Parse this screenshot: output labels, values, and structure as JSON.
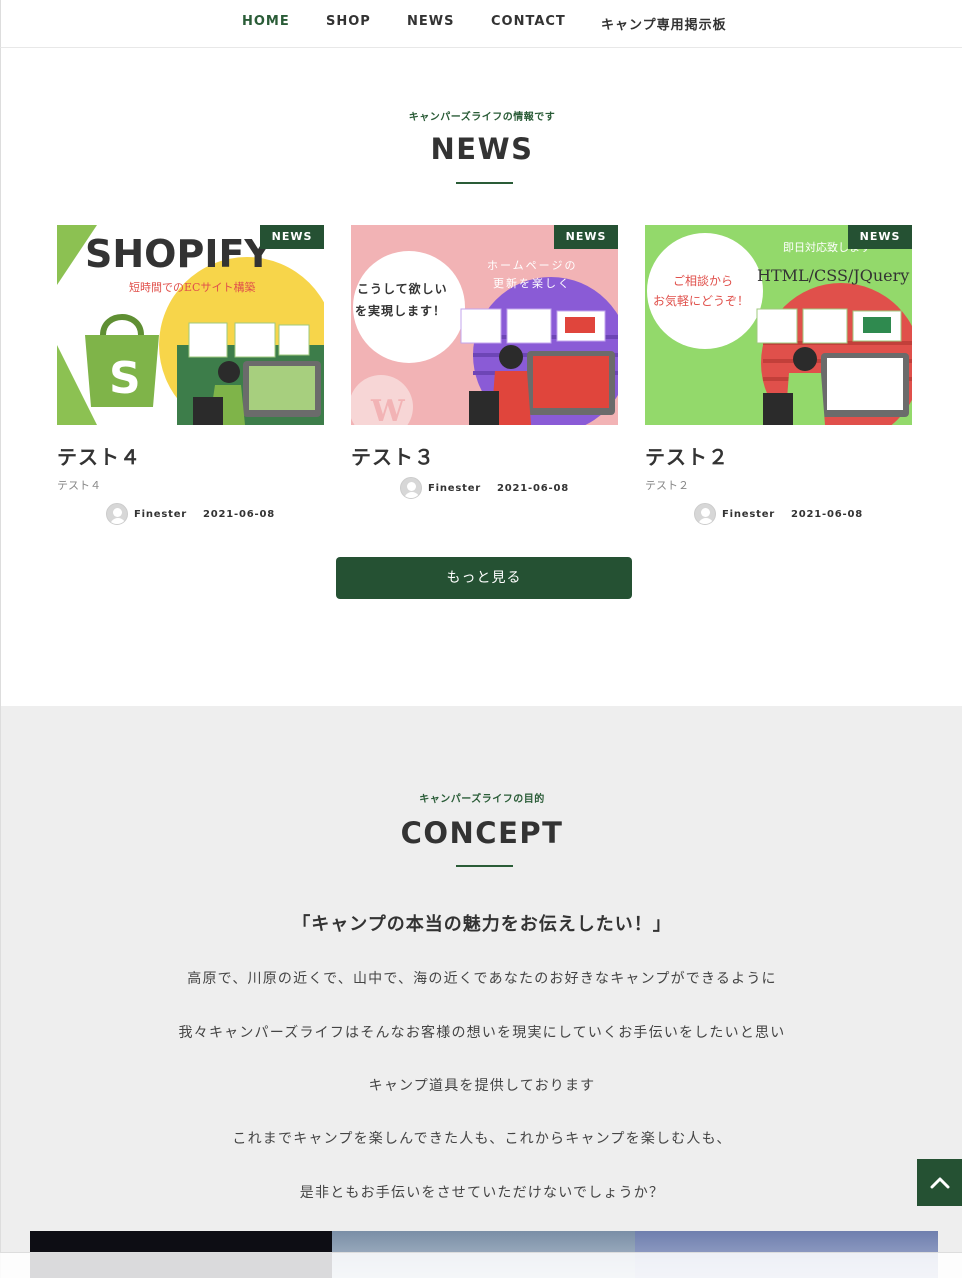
{
  "nav": {
    "items": [
      {
        "label": "HOME",
        "active": true
      },
      {
        "label": "SHOP",
        "active": false
      },
      {
        "label": "NEWS",
        "active": false
      },
      {
        "label": "CONTACT",
        "active": false
      },
      {
        "label": "キャンプ専用掲示板",
        "active": false
      }
    ]
  },
  "news": {
    "subtitle": "キャンパーズライフの情報です",
    "title": "NEWS",
    "cards": [
      {
        "badge": "NEWS",
        "title": "テスト４",
        "excerpt": "テスト４",
        "author": "Finester",
        "date": "2021-06-08",
        "image": {
          "headline": "SHOPIFY",
          "caption": "短時間でのECサイト構築"
        }
      },
      {
        "badge": "NEWS",
        "title": "テスト３",
        "excerpt": "",
        "author": "Finester",
        "date": "2021-06-08",
        "image": {
          "bubble_line1": "こうして欲しい",
          "bubble_line2": "を実現します！",
          "caption_line1": "ホームページの",
          "caption_line2": "更新を楽しく"
        }
      },
      {
        "badge": "NEWS",
        "title": "テスト２",
        "excerpt": "テスト２",
        "author": "Finester",
        "date": "2021-06-08",
        "image": {
          "top_text": "即日対応致します",
          "headline": "HTML/CSS/JQuery",
          "bubble_line1": "ご相談から",
          "bubble_line2": "お気軽にどうぞ！"
        }
      }
    ],
    "more_label": "もっと見る"
  },
  "concept": {
    "subtitle": "キャンパーズライフの目的",
    "title": "CONCEPT",
    "lead": "「キャンプの本当の魅力をお伝えしたい！」",
    "paragraphs": [
      "高原で、川原の近くで、山中で、海の近くであなたのお好きなキャンプができるように",
      "我々キャンパーズライフはそんなお客様の想いを現実にしていくお手伝いをしたいと思い",
      "キャンプ道具を提供しております",
      "これまでキャンプを楽しんできた人も、これからキャンプを楽しむ人も、",
      "是非ともお手伝いをさせていただけないでしょうか？"
    ]
  },
  "colors": {
    "accent": "#255133",
    "accent_text": "#2a5c37",
    "concept_bg": "#eeeeee"
  },
  "icons": {
    "scroll_top": "chevron-up-icon",
    "avatar": "default-avatar-icon"
  }
}
